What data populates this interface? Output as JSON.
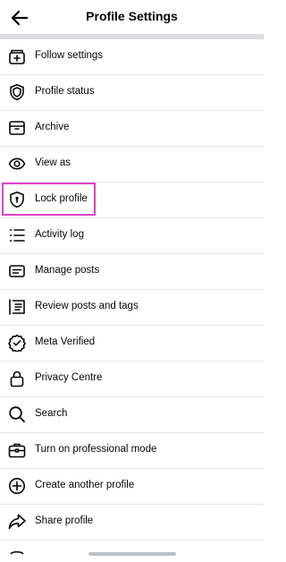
{
  "header": {
    "title": "Profile Settings",
    "back_icon": "arrow-left-icon"
  },
  "items": [
    {
      "label": "Follow settings",
      "icon": "follow-settings-icon"
    },
    {
      "label": "Profile status",
      "icon": "shield-icon"
    },
    {
      "label": "Archive",
      "icon": "archive-icon"
    },
    {
      "label": "View as",
      "icon": "eye-icon"
    },
    {
      "label": "Lock profile",
      "icon": "lock-shield-icon",
      "highlighted": true
    },
    {
      "label": "Activity log",
      "icon": "list-icon"
    },
    {
      "label": "Manage posts",
      "icon": "manage-posts-icon"
    },
    {
      "label": "Review posts and tags",
      "icon": "review-posts-icon"
    },
    {
      "label": "Meta Verified",
      "icon": "verified-badge-icon"
    },
    {
      "label": "Privacy Centre",
      "icon": "padlock-icon"
    },
    {
      "label": "Search",
      "icon": "search-icon"
    },
    {
      "label": "Turn on professional mode",
      "icon": "briefcase-icon"
    },
    {
      "label": "Create another profile",
      "icon": "plus-circle-icon"
    },
    {
      "label": "Share profile",
      "icon": "share-arrow-icon"
    }
  ],
  "highlight_color": "#e043c9"
}
